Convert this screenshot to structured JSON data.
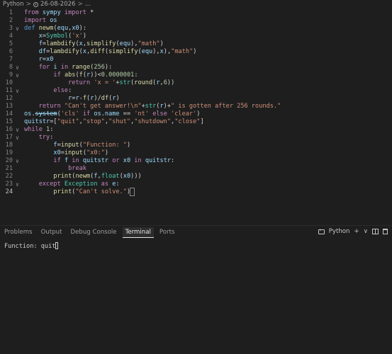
{
  "breadcrumb": {
    "language": "Python",
    "sep": ">",
    "date": "26-08-2026",
    "rest": "..."
  },
  "editor": {
    "lines": [
      {
        "n": "1",
        "fold": "",
        "tokens": [
          [
            "kw",
            "from "
          ],
          [
            "id",
            "sympy "
          ],
          [
            "kw",
            "import "
          ],
          [
            "op",
            "*"
          ]
        ]
      },
      {
        "n": "2",
        "fold": "",
        "tokens": [
          [
            "kw",
            "import "
          ],
          [
            "id",
            "os"
          ]
        ]
      },
      {
        "n": "3",
        "fold": "v",
        "tokens": [
          [
            "def",
            "def "
          ],
          [
            "fn",
            "newm"
          ],
          [
            "op",
            "("
          ],
          [
            "id",
            "equ"
          ],
          [
            "op",
            ","
          ],
          [
            "id",
            "x0"
          ],
          [
            "op",
            "):"
          ]
        ]
      },
      {
        "n": "4",
        "fold": "",
        "tokens": [
          [
            "op",
            "    "
          ],
          [
            "id",
            "x"
          ],
          [
            "op",
            "="
          ],
          [
            "cls",
            "Symbol"
          ],
          [
            "op",
            "("
          ],
          [
            "str",
            "'x'"
          ],
          [
            "op",
            ")"
          ]
        ]
      },
      {
        "n": "5",
        "fold": "",
        "tokens": [
          [
            "op",
            "    "
          ],
          [
            "id",
            "f"
          ],
          [
            "op",
            "="
          ],
          [
            "fn",
            "lambdify"
          ],
          [
            "op",
            "("
          ],
          [
            "id",
            "x"
          ],
          [
            "op",
            ","
          ],
          [
            "fn",
            "simplify"
          ],
          [
            "op",
            "("
          ],
          [
            "id",
            "equ"
          ],
          [
            "op",
            "),"
          ],
          [
            "str",
            "\"math\""
          ],
          [
            "op",
            ")"
          ]
        ]
      },
      {
        "n": "6",
        "fold": "",
        "tokens": [
          [
            "op",
            "    "
          ],
          [
            "id",
            "df"
          ],
          [
            "op",
            "="
          ],
          [
            "fn",
            "lambdify"
          ],
          [
            "op",
            "("
          ],
          [
            "id",
            "x"
          ],
          [
            "op",
            ","
          ],
          [
            "fn",
            "diff"
          ],
          [
            "op",
            "("
          ],
          [
            "fn",
            "simplify"
          ],
          [
            "op",
            "("
          ],
          [
            "id",
            "equ"
          ],
          [
            "op",
            "),"
          ],
          [
            "id",
            "x"
          ],
          [
            "op",
            "),"
          ],
          [
            "str",
            "\"math\""
          ],
          [
            "op",
            ")"
          ]
        ]
      },
      {
        "n": "7",
        "fold": "",
        "tokens": [
          [
            "op",
            "    "
          ],
          [
            "id",
            "r"
          ],
          [
            "op",
            "="
          ],
          [
            "id",
            "x0"
          ]
        ]
      },
      {
        "n": "8",
        "fold": "v",
        "tokens": [
          [
            "op",
            "    "
          ],
          [
            "kw",
            "for "
          ],
          [
            "id",
            "i "
          ],
          [
            "kw",
            "in "
          ],
          [
            "fn",
            "range"
          ],
          [
            "op",
            "("
          ],
          [
            "num",
            "256"
          ],
          [
            "op",
            "):"
          ]
        ]
      },
      {
        "n": "9",
        "fold": "v",
        "tokens": [
          [
            "op",
            "        "
          ],
          [
            "kw",
            "if "
          ],
          [
            "fn",
            "abs"
          ],
          [
            "op",
            "("
          ],
          [
            "fn",
            "f"
          ],
          [
            "op",
            "("
          ],
          [
            "id",
            "r"
          ],
          [
            "op",
            "))<"
          ],
          [
            "num",
            "0.0000001"
          ],
          [
            "op",
            ":"
          ]
        ]
      },
      {
        "n": "10",
        "fold": "",
        "tokens": [
          [
            "op",
            "            "
          ],
          [
            "kw",
            "return "
          ],
          [
            "str",
            "'x = '"
          ],
          [
            "op",
            "+"
          ],
          [
            "cls",
            "str"
          ],
          [
            "op",
            "("
          ],
          [
            "fn",
            "round"
          ],
          [
            "op",
            "("
          ],
          [
            "id",
            "r"
          ],
          [
            "op",
            ","
          ],
          [
            "num",
            "6"
          ],
          [
            "op",
            "))"
          ]
        ]
      },
      {
        "n": "11",
        "fold": "v",
        "tokens": [
          [
            "op",
            "        "
          ],
          [
            "kw",
            "else"
          ],
          [
            "op",
            ":"
          ]
        ]
      },
      {
        "n": "12",
        "fold": "",
        "tokens": [
          [
            "op",
            "            "
          ],
          [
            "id",
            "r"
          ],
          [
            "op",
            "="
          ],
          [
            "id",
            "r"
          ],
          [
            "op",
            "-"
          ],
          [
            "fn",
            "f"
          ],
          [
            "op",
            "("
          ],
          [
            "id",
            "r"
          ],
          [
            "op",
            ")/"
          ],
          [
            "fn",
            "df"
          ],
          [
            "op",
            "("
          ],
          [
            "id",
            "r"
          ],
          [
            "op",
            ")"
          ]
        ]
      },
      {
        "n": "13",
        "fold": "",
        "tokens": [
          [
            "op",
            "    "
          ],
          [
            "kw",
            "return "
          ],
          [
            "str",
            "\"Can't get answer!\\n\""
          ],
          [
            "op",
            "+"
          ],
          [
            "cls",
            "str"
          ],
          [
            "op",
            "("
          ],
          [
            "id",
            "r"
          ],
          [
            "op",
            ")+"
          ],
          [
            "str",
            "\" is gotten after 256 rounds.\""
          ]
        ]
      },
      {
        "n": "14",
        "fold": "",
        "tokens": [
          [
            "id",
            "os"
          ],
          [
            "op",
            "."
          ],
          [
            "strike",
            "system"
          ],
          [
            "op",
            "("
          ],
          [
            "str",
            "'cls'"
          ],
          [
            "kw",
            " if "
          ],
          [
            "id",
            "os"
          ],
          [
            "op",
            "."
          ],
          [
            "id",
            "name "
          ],
          [
            "op",
            "== "
          ],
          [
            "str",
            "'nt'"
          ],
          [
            "kw",
            " else "
          ],
          [
            "str",
            "'clear'"
          ],
          [
            "op",
            ")"
          ]
        ]
      },
      {
        "n": "15",
        "fold": "",
        "tokens": [
          [
            "id",
            "quitstr"
          ],
          [
            "op",
            "=["
          ],
          [
            "str",
            "\"quit\""
          ],
          [
            "op",
            ","
          ],
          [
            "str",
            "\"stop\""
          ],
          [
            "op",
            ","
          ],
          [
            "str",
            "\"shut\""
          ],
          [
            "op",
            ","
          ],
          [
            "str",
            "\"shutdown\""
          ],
          [
            "op",
            ","
          ],
          [
            "str",
            "\"close\""
          ],
          [
            "op",
            "]"
          ]
        ]
      },
      {
        "n": "16",
        "fold": "v",
        "tokens": [
          [
            "kw",
            "while "
          ],
          [
            "num",
            "1"
          ],
          [
            "op",
            ":"
          ]
        ]
      },
      {
        "n": "17",
        "fold": "v",
        "tokens": [
          [
            "op",
            "    "
          ],
          [
            "kw",
            "try"
          ],
          [
            "op",
            ":"
          ]
        ]
      },
      {
        "n": "18",
        "fold": "",
        "tokens": [
          [
            "op",
            "        "
          ],
          [
            "id",
            "f"
          ],
          [
            "op",
            "="
          ],
          [
            "fn",
            "input"
          ],
          [
            "op",
            "("
          ],
          [
            "str",
            "\"Function: \""
          ],
          [
            "op",
            ")"
          ]
        ]
      },
      {
        "n": "19",
        "fold": "",
        "tokens": [
          [
            "op",
            "        "
          ],
          [
            "id",
            "x0"
          ],
          [
            "op",
            "="
          ],
          [
            "fn",
            "input"
          ],
          [
            "op",
            "("
          ],
          [
            "str",
            "\"x0:\""
          ],
          [
            "op",
            ")"
          ]
        ]
      },
      {
        "n": "20",
        "fold": "v",
        "tokens": [
          [
            "op",
            "        "
          ],
          [
            "kw",
            "if "
          ],
          [
            "id",
            "f "
          ],
          [
            "kw",
            "in "
          ],
          [
            "id",
            "quitstr "
          ],
          [
            "kw",
            "or "
          ],
          [
            "id",
            "x0 "
          ],
          [
            "kw",
            "in "
          ],
          [
            "id",
            "quitstr"
          ],
          [
            "op",
            ":"
          ]
        ]
      },
      {
        "n": "21",
        "fold": "",
        "tokens": [
          [
            "op",
            "            "
          ],
          [
            "kw",
            "break"
          ]
        ]
      },
      {
        "n": "22",
        "fold": "",
        "tokens": [
          [
            "op",
            "        "
          ],
          [
            "fn",
            "print"
          ],
          [
            "op",
            "("
          ],
          [
            "fn",
            "newm"
          ],
          [
            "op",
            "("
          ],
          [
            "id",
            "f"
          ],
          [
            "op",
            ","
          ],
          [
            "cls",
            "float"
          ],
          [
            "op",
            "("
          ],
          [
            "id",
            "x0"
          ],
          [
            "op",
            ")))"
          ]
        ]
      },
      {
        "n": "23",
        "fold": "v",
        "tokens": [
          [
            "op",
            "    "
          ],
          [
            "kw",
            "except "
          ],
          [
            "cls",
            "Exception "
          ],
          [
            "kw",
            "as "
          ],
          [
            "id",
            "e"
          ],
          [
            "op",
            ":"
          ]
        ]
      },
      {
        "n": "24",
        "fold": "",
        "tokens": [
          [
            "op",
            "        "
          ],
          [
            "fn",
            "print"
          ],
          [
            "op",
            "("
          ],
          [
            "str",
            "\"Can't solve.\""
          ],
          [
            "op",
            ")"
          ]
        ]
      }
    ]
  },
  "panel": {
    "tabs": [
      "Problems",
      "Output",
      "Debug Console",
      "Terminal",
      "Ports"
    ],
    "active_tab": "Terminal",
    "terminal_profile": "Python",
    "add_label": "+",
    "dropdown_label": "∨",
    "more_label": "···"
  },
  "terminal": {
    "prompt": "Function: ",
    "input": "quit"
  },
  "colors": {
    "background": "#1e1e1e",
    "keyword": "#c586c0",
    "string": "#ce9178",
    "function": "#dcdcaa"
  }
}
